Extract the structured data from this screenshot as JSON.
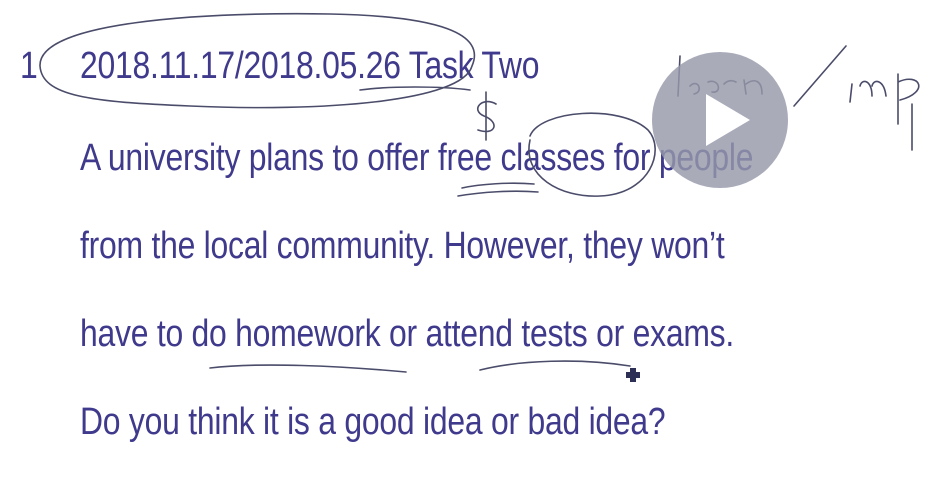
{
  "slide": {
    "item_number": "1",
    "heading_date": "2018.11.17/2018.05.26",
    "heading_task": "Task Two",
    "lines": [
      "A university plans to offer free classes for people",
      "from the local community. However, they won’t",
      "have to do homework or attend tests or exams.",
      "Do you think it is a good idea or bad idea?"
    ]
  },
  "annotations": {
    "dollar_note": "$",
    "margin_note": "learn / imp"
  },
  "player": {
    "play_icon": "play-icon"
  },
  "colors": {
    "text": "#3f3a8c",
    "ink": "#4a4c6a",
    "play_overlay": "#9698aa"
  }
}
